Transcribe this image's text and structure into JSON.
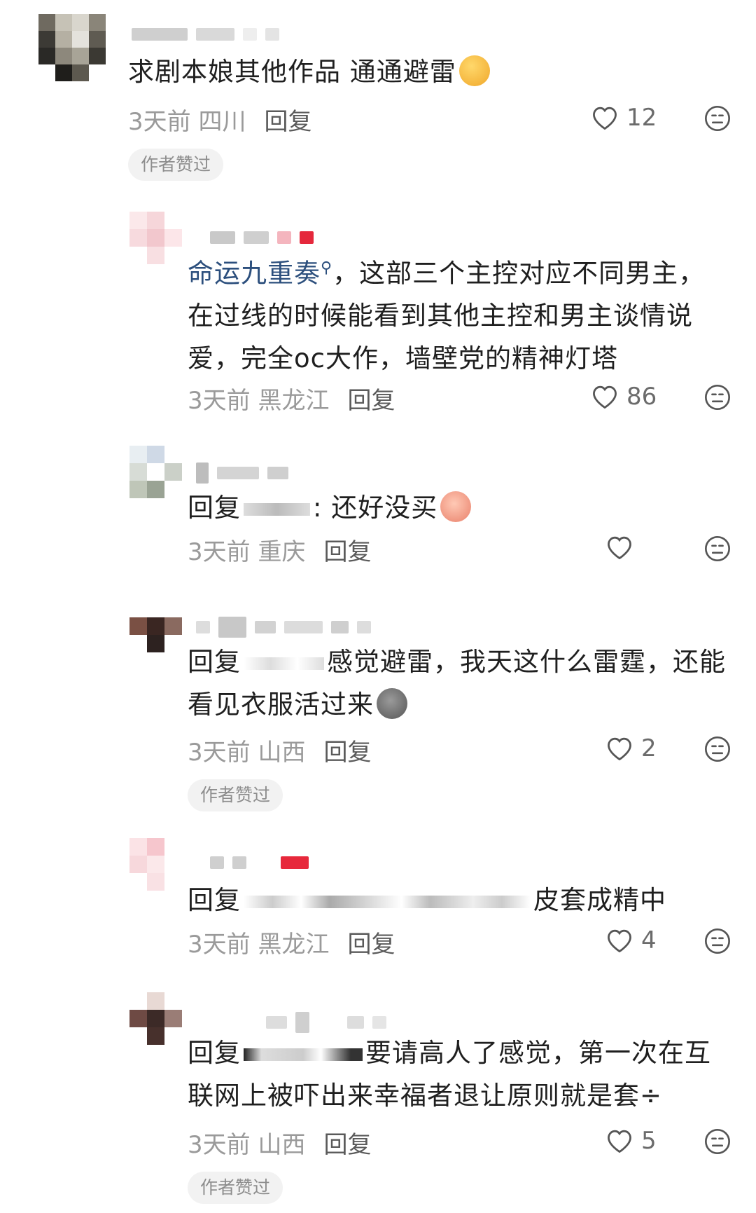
{
  "comments": [
    {
      "text": "求剧本娘其他作品 通通避雷",
      "time": "3天前",
      "location": "四川",
      "reply_label": "回复",
      "likes": "12",
      "badge": "作者赞过"
    },
    {
      "link_text": "命运九重奏",
      "text": "，这部三个主控对应不同男主，在过线的时候能看到其他主控和男主谈情说爱，完全oc大作，墙壁党的精神灯塔",
      "time": "3天前",
      "location": "黑龙江",
      "reply_label": "回复",
      "likes": "86"
    },
    {
      "text_prefix": "回复",
      "text": ": 还好没买",
      "time": "3天前",
      "location": "重庆",
      "reply_label": "回复",
      "likes": ""
    },
    {
      "text_prefix": "回复",
      "text": "感觉避雷，我天这什么雷霆，还能看见衣服活过来",
      "time": "3天前",
      "location": "山西",
      "reply_label": "回复",
      "likes": "2",
      "badge": "作者赞过"
    },
    {
      "text_prefix": "回复",
      "text": "皮套成精中",
      "time": "3天前",
      "location": "黑龙江",
      "reply_label": "回复",
      "likes": "4"
    },
    {
      "text_prefix": "回复",
      "text": "要请高人了感觉，第一次在互联网上被吓出来幸福者退让原则就是套÷",
      "time": "3天前",
      "location": "山西",
      "reply_label": "回复",
      "likes": "5",
      "badge": "作者赞过"
    }
  ],
  "icons": {
    "like": "heart-outline-icon",
    "dislike": "neutral-face-icon"
  },
  "colors": {
    "link": "#2c4f7d",
    "meta": "#9a9a9a",
    "badge_bg": "#f2f2f2"
  }
}
